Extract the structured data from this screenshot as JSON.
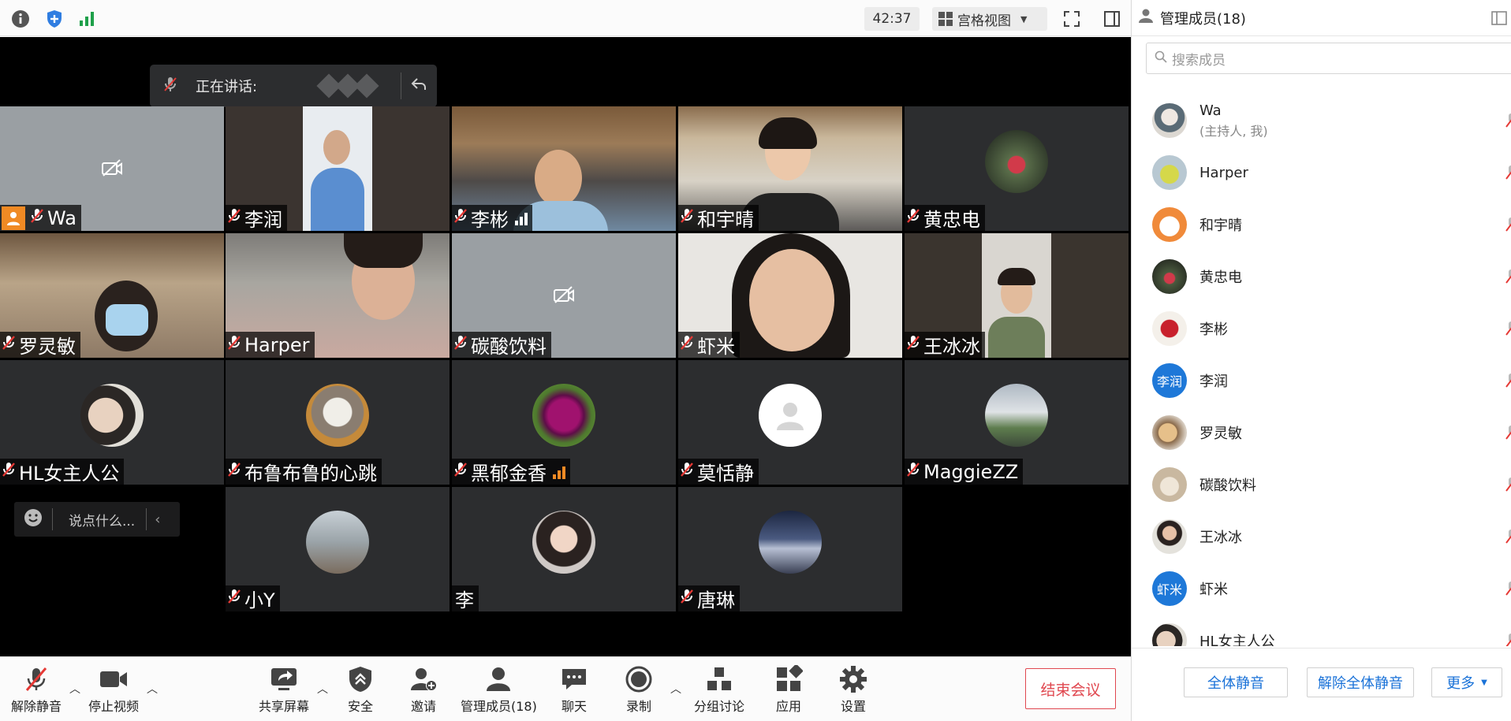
{
  "topbar": {
    "timer": "42:37",
    "view_mode": "宫格视图",
    "icons": [
      "info-icon",
      "shield-icon",
      "signal-icon",
      "fullscreen-icon",
      "sidebar-icon"
    ]
  },
  "speaking": {
    "label": "正在讲话:"
  },
  "tiles": {
    "t0": {
      "name": "Wa"
    },
    "t1": {
      "name": "李润"
    },
    "t2": {
      "name": "李彬"
    },
    "t3": {
      "name": "和宇晴"
    },
    "t4": {
      "name": "黄忠电"
    },
    "t5": {
      "name": "罗灵敏"
    },
    "t6": {
      "name": "Harper"
    },
    "t7": {
      "name": "碳酸饮料"
    },
    "t8": {
      "name": "虾米"
    },
    "t9": {
      "name": "王冰冰"
    },
    "t10": {
      "name": "HL女主人公"
    },
    "t11": {
      "name": "布鲁布鲁的心跳"
    },
    "t12": {
      "name": "黑郁金香"
    },
    "t13": {
      "name": "莫恬静"
    },
    "t14": {
      "name": "MaggieZZ"
    },
    "t15": {
      "name": "小Y"
    },
    "t16": {
      "name": "李"
    },
    "t17": {
      "name": "唐琳"
    }
  },
  "chat_popup": {
    "placeholder": "说点什么..."
  },
  "toolbar": {
    "unmute": "解除静音",
    "stop_video": "停止视频",
    "share_screen": "共享屏幕",
    "security": "安全",
    "invite": "邀请",
    "manage_members": "管理成员(18)",
    "chat": "聊天",
    "record": "录制",
    "breakout": "分组讨论",
    "apps": "应用",
    "settings": "设置",
    "end_meeting": "结束会议"
  },
  "panel": {
    "title": "管理成员(18)",
    "search_placeholder": "搜索成员",
    "members": [
      {
        "name": "Wa",
        "sub": "(主持人, 我)"
      },
      {
        "name": "Harper"
      },
      {
        "name": "和宇晴"
      },
      {
        "name": "黄忠电"
      },
      {
        "name": "李彬"
      },
      {
        "name": "李润",
        "avatar_text": "李润"
      },
      {
        "name": "罗灵敏"
      },
      {
        "name": "碳酸饮料"
      },
      {
        "name": "王冰冰"
      },
      {
        "name": "虾米",
        "avatar_text": "虾米"
      },
      {
        "name": "HL女主人公"
      }
    ],
    "mute_all": "全体静音",
    "unmute_all": "解除全体静音",
    "more": "更多"
  },
  "colors": {
    "accent_blue": "#1a72d8",
    "end_red": "#e0474f",
    "mic_red": "#e53935",
    "signal_orange": "#f08a24"
  }
}
